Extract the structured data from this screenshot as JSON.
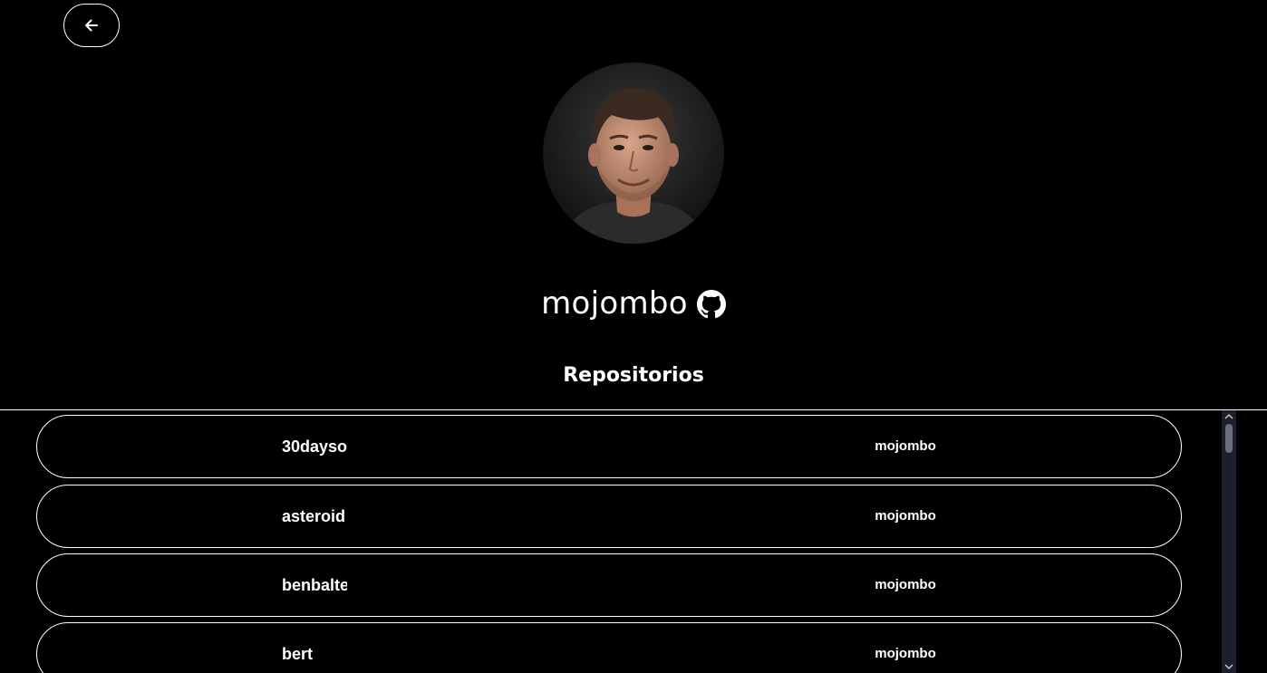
{
  "header": {
    "back_icon": "arrow-left-icon"
  },
  "profile": {
    "username": "mojombo",
    "github_icon": "github-icon"
  },
  "repositories": {
    "title": "Repositorios",
    "items": [
      {
        "name": "30dayso",
        "owner": "mojombo"
      },
      {
        "name": "asteroid",
        "owner": "mojombo"
      },
      {
        "name": "benbalte",
        "owner": "mojombo"
      },
      {
        "name": "bert",
        "owner": "mojombo"
      }
    ]
  },
  "colors": {
    "background": "#000000",
    "foreground": "#ffffff",
    "scrollbar_track": "#1c1f29",
    "scrollbar_thumb": "#6b6f7a"
  }
}
